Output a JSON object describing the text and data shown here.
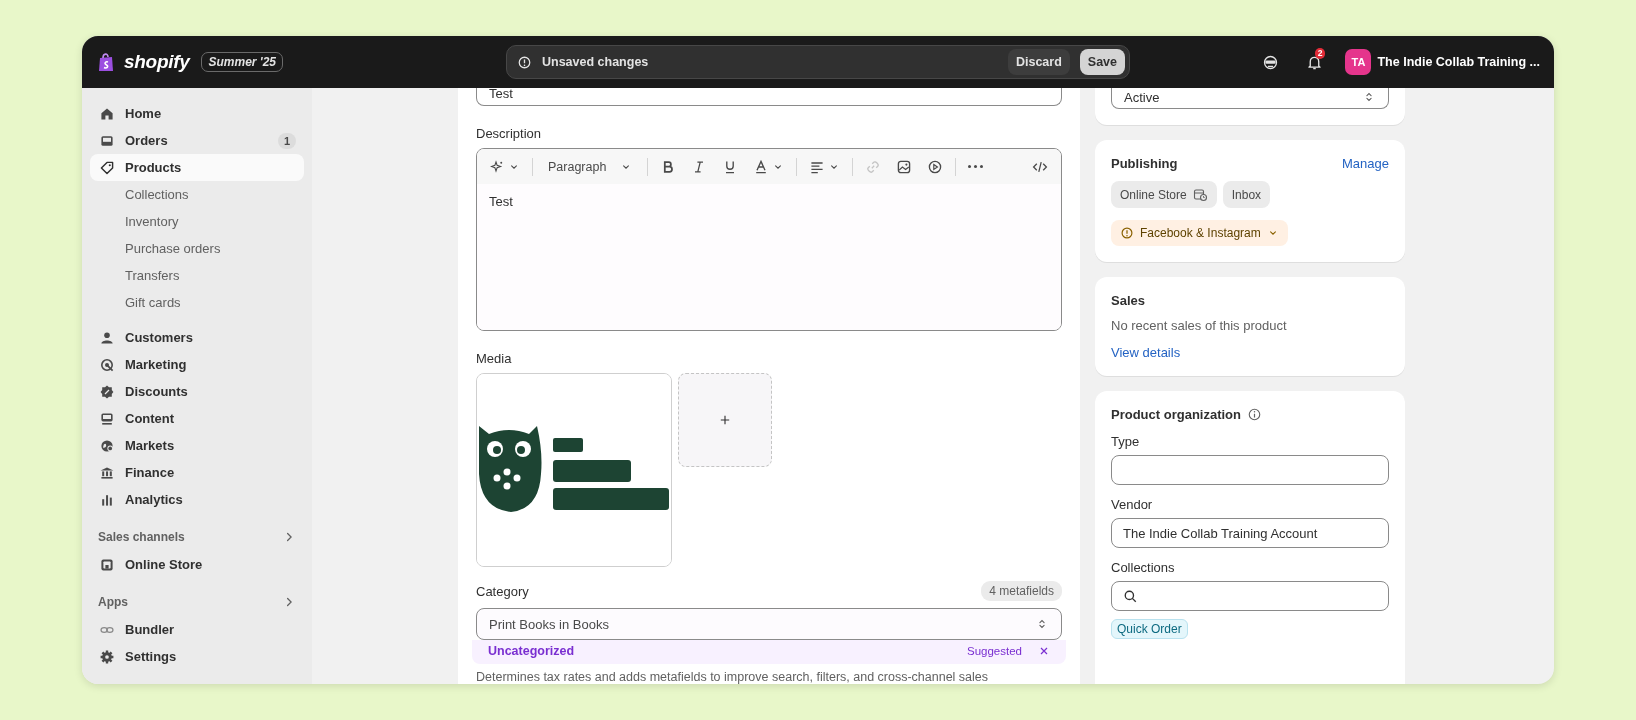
{
  "top_bar": {
    "logo": "shopify",
    "edition_badge": "Summer '25",
    "unsaved_bar": {
      "message": "Unsaved changes",
      "buttons": [
        {
          "label": "Discard",
          "kind": "secondary"
        },
        {
          "label": "Save",
          "kind": "primary"
        }
      ]
    },
    "notification_count": "2",
    "account": {
      "initials": "TA",
      "name": "The Indie Collab Training ..."
    }
  },
  "sidebar": {
    "items": [
      {
        "label": "Home",
        "selected": false
      },
      {
        "label": "Orders",
        "badge": "1",
        "selected": false
      },
      {
        "label": "Products",
        "selected": true,
        "children": [
          {
            "label": "Collections",
            "selected": false
          },
          {
            "label": "Inventory",
            "selected": false
          },
          {
            "label": "Purchase orders",
            "selected": false
          },
          {
            "label": "Transfers",
            "selected": false
          },
          {
            "label": "Gift cards",
            "selected": false
          }
        ]
      },
      {
        "label": "Customers",
        "selected": false
      },
      {
        "label": "Marketing",
        "selected": false
      },
      {
        "label": "Discounts",
        "selected": false
      },
      {
        "label": "Content",
        "selected": false
      },
      {
        "label": "Markets",
        "selected": false
      },
      {
        "label": "Finance",
        "selected": false
      },
      {
        "label": "Analytics",
        "selected": false
      }
    ],
    "sections": [
      {
        "title": "Sales channels",
        "items": [
          {
            "label": "Online Store",
            "selected": false
          }
        ]
      },
      {
        "title": "Apps",
        "items": [
          {
            "label": "Bundler",
            "selected": false
          },
          {
            "label": "Settings",
            "selected": false
          }
        ]
      }
    ]
  },
  "product_form": {
    "title_field": {
      "value": "Test"
    },
    "description": {
      "label": "Description",
      "toolbar": {
        "format": "Paragraph",
        "link_enabled": false
      },
      "value": "Test"
    },
    "media": {
      "label": "Media"
    },
    "category": {
      "label": "Category",
      "badge": "4 metafields",
      "value": "Print Books in Books",
      "suggestion": {
        "value": "Uncategorized",
        "tag": "Suggested"
      },
      "help_text": "Determines tax rates and adds metafields to improve search, filters, and cross-channel sales"
    }
  },
  "side_panel": {
    "status": {
      "value": "Active"
    },
    "publishing": {
      "title": "Publishing",
      "action": "Manage",
      "channels": [
        {
          "label": "Online Store",
          "kind": "scheduled"
        },
        {
          "label": "Inbox",
          "kind": "plain"
        },
        {
          "label": "Facebook & Instagram",
          "kind": "warning"
        }
      ]
    },
    "sales": {
      "title": "Sales",
      "text": "No recent sales of this product",
      "link": "View details"
    },
    "organization": {
      "title": "Product organization",
      "fields": [
        {
          "label": "Type",
          "kind": "text"
        },
        {
          "label": "Vendor",
          "kind": "text",
          "value": "The Indie Collab Training Account"
        },
        {
          "label": "Collections",
          "kind": "search",
          "chips": [
            "Quick Order"
          ]
        }
      ]
    }
  }
}
